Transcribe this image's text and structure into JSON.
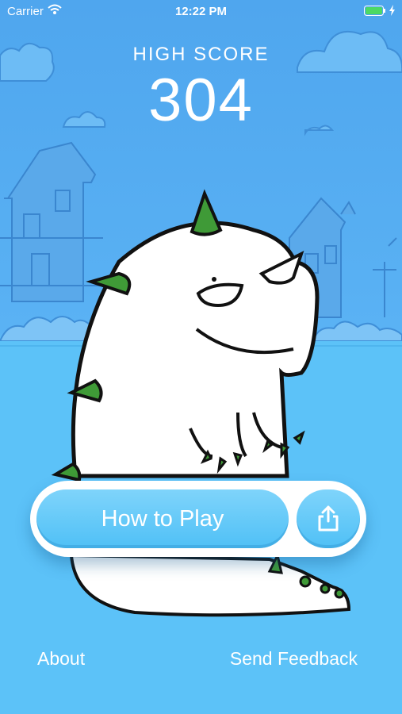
{
  "status_bar": {
    "carrier": "Carrier",
    "time": "12:22 PM",
    "wifi_icon": "wifi-icon",
    "battery_icon": "battery-icon",
    "charging_icon": "charging-icon"
  },
  "score": {
    "label": "HIGH SCORE",
    "value": "304"
  },
  "buttons": {
    "how_to_play": "How to Play",
    "share_icon": "share-icon"
  },
  "footer": {
    "about": "About",
    "send_feedback": "Send Feedback"
  },
  "colors": {
    "sky": "#4fa6ee",
    "ground": "#5cc2f8",
    "button": "#5ac4f8",
    "monster_body": "#ffffff",
    "monster_spikes": "#3f9a37",
    "text": "#ffffff"
  }
}
